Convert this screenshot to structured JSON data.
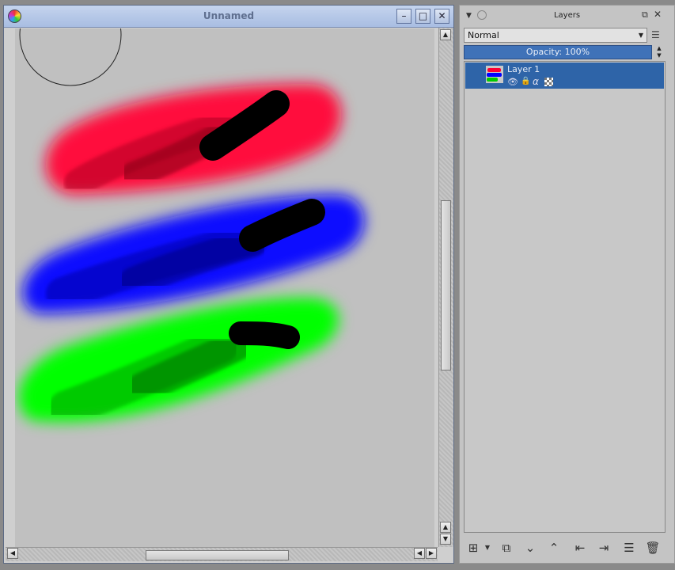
{
  "canvas_window": {
    "title": "Unnamed",
    "controls": {
      "minimize": "–",
      "maximize": "□",
      "close": "✕"
    }
  },
  "layers_docker": {
    "title": "Layers",
    "blend_mode": "Normal",
    "opacity_label": "Opacity:  100%",
    "layers": [
      {
        "name": "Layer 1"
      }
    ],
    "toolbar": [
      "add-layer",
      "duplicate-layer",
      "move-down",
      "move-up",
      "move-out",
      "move-into",
      "layer-properties",
      "delete-layer"
    ]
  },
  "colors": {
    "stroke_red": "#ff0033",
    "stroke_blue": "#0000ff",
    "stroke_green": "#00ff00",
    "selection": "#2e64a8"
  }
}
